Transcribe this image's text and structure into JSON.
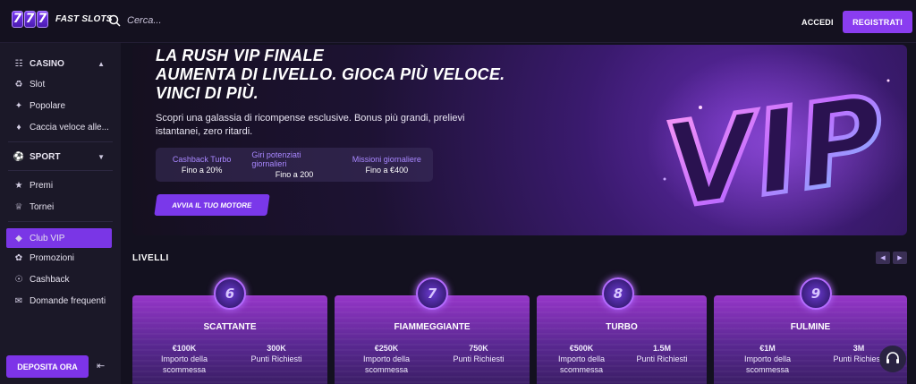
{
  "header": {
    "logo_digits": [
      "7",
      "7",
      "7"
    ],
    "logo_text": "FAST SLOTS",
    "search_placeholder": "Cerca...",
    "login_label": "ACCEDI",
    "register_label": "REGISTRATI"
  },
  "sidebar": {
    "casino_group": "CASINO",
    "casino_items": [
      "Slot",
      "Popolare",
      "Caccia veloce alle..."
    ],
    "sport_group": "SPORT",
    "misc_items": [
      "Premi",
      "Tornei"
    ],
    "vip_item": "Club VIP",
    "more_items": [
      "Promozioni",
      "Cashback",
      "Domande frequenti"
    ],
    "deposit_label": "DEPOSITA ORA"
  },
  "hero": {
    "title_lines": [
      "LA RUSH VIP FINALE",
      "AUMENTA DI LIVELLO. GIOCA PIÙ VELOCE.",
      "VINCI DI PIÙ."
    ],
    "subtitle": "Scopri una galassia di ricompense esclusive. Bonus più grandi, prelievi istantanei, zero ritardi.",
    "perks": [
      {
        "name": "Cashback Turbo",
        "value": "Fino a 20%"
      },
      {
        "name": "Giri potenziati giornalieri",
        "value": "Fino a 200"
      },
      {
        "name": "Missioni giornaliere",
        "value": "Fino a €400"
      }
    ],
    "cta_label": "AVVIA IL TUO MOTORE",
    "art_text": "VIP"
  },
  "levels": {
    "title": "LIVELLI",
    "cards": [
      {
        "badge": "6",
        "name": "SCATTANTE",
        "bet_value": "€100K",
        "bet_label": "Importo della scommessa",
        "points_value": "300K",
        "points_label": "Punti Richiesti"
      },
      {
        "badge": "7",
        "name": "FIAMMEGGIANTE",
        "bet_value": "€250K",
        "bet_label": "Importo della scommessa",
        "points_value": "750K",
        "points_label": "Punti Richiesti"
      },
      {
        "badge": "8",
        "name": "TURBO",
        "bet_value": "€500K",
        "bet_label": "Importo della scommessa",
        "points_value": "1.5M",
        "points_label": "Punti Richiesti"
      },
      {
        "badge": "9",
        "name": "FULMINE",
        "bet_value": "€1M",
        "bet_label": "Importo della scommessa",
        "points_value": "3M",
        "points_label": "Punti Richiesti"
      }
    ]
  }
}
